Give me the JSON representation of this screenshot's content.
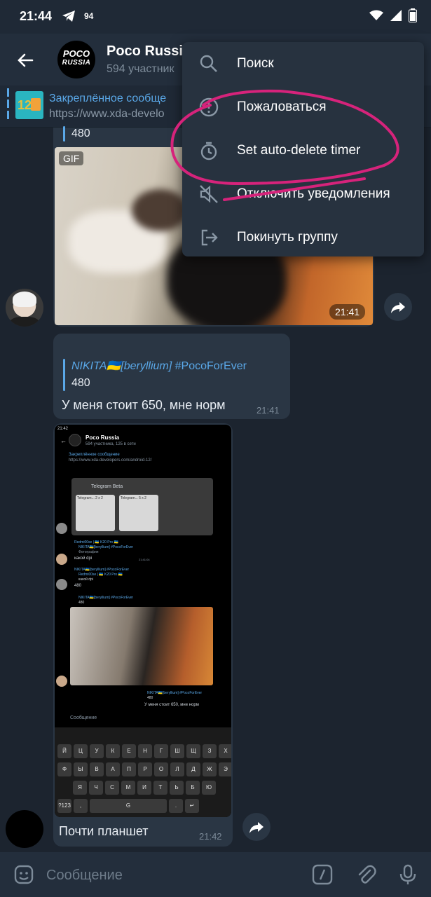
{
  "status_bar": {
    "time": "21:44",
    "count": "94"
  },
  "header": {
    "avatar_line1": "POCO",
    "avatar_line2": "RUSSIA",
    "title": "Poco Russia",
    "subtitle": "594 участник"
  },
  "pinned": {
    "thumb_text": "12",
    "title": "Закреплённое сообще",
    "text": "https://www.xda-develo"
  },
  "messages": [
    {
      "reply_fragment": "480",
      "badge": "GIF",
      "time": "21:41"
    },
    {
      "reply_author": "NIKITA🇺🇦[beryllium]",
      "reply_tag": "#PocoForEver",
      "reply_text": "480",
      "text": "У меня стоит 650, мне норм",
      "time": "21:41"
    },
    {
      "caption": "Почти планшет",
      "time": "21:42",
      "screenshot": {
        "time": "21:42",
        "title": "Poco Russia",
        "subtitle": "594 участника, 125 в сети",
        "pinned": "Закреплённое сообщение",
        "pinned_url": "https://www.xda-developers.com/android-12/",
        "card_title": "Telegram Beta",
        "card_w1": "Telegram... 2 x 2",
        "card_w2": "Telegram... 5 x 2",
        "m1_author": "Redmi00se | 🇺🇦 K20 Pro 🇺🇦",
        "m1_reply": "NIKITA🇺🇦[beryllium] #PocoForEver",
        "m1_reply2": "Фотография",
        "m1_text": "какой dpi",
        "m1_time": "21:41:04",
        "m2_author": "NIKITA🇺🇦[beryllium] #PocoForEver",
        "m2_reply": "Redmi00se | 🇺🇦 K20 Pro 🇺🇦",
        "m2_reply2": "какой dpi",
        "m2_text": "480",
        "m3_reply": "NIKITA🇺🇦[beryllium] #PocoForEver",
        "m3_text": "480",
        "m4_reply": "NIKITA🇺🇦[beryllium] #PocoForEver",
        "m4_reply2": "480",
        "m4_text": "У меня стоит 650, мне норм",
        "input_placeholder": "Сообщение",
        "kb_row1": [
          "Й",
          "Ц",
          "У",
          "К",
          "Е",
          "Н",
          "Г",
          "Ш",
          "Щ",
          "З",
          "Х"
        ],
        "kb_row2": [
          "Ф",
          "Ы",
          "В",
          "А",
          "П",
          "Р",
          "О",
          "Л",
          "Д",
          "Ж",
          "Э"
        ],
        "kb_row3": [
          "Я",
          "Ч",
          "С",
          "М",
          "И",
          "Т",
          "Ь",
          "Б",
          "Ю"
        ],
        "kb_bottom": [
          "?123",
          ",",
          "G",
          ".",
          "↵"
        ]
      }
    }
  ],
  "menu": {
    "items": [
      {
        "label": "Поиск",
        "icon": "search-icon"
      },
      {
        "label": "Пожаловаться",
        "icon": "report-icon"
      },
      {
        "label": "Set auto-delete timer",
        "icon": "timer-icon"
      },
      {
        "label": "Отключить уведомления",
        "icon": "mute-icon"
      },
      {
        "label": "Покинуть группу",
        "icon": "leave-icon"
      }
    ]
  },
  "input": {
    "placeholder": "Сообщение"
  },
  "colors": {
    "accent": "#5aa8e8",
    "background": "#1c242f",
    "bubble": "#2a3644",
    "annotation": "#d6237b"
  }
}
